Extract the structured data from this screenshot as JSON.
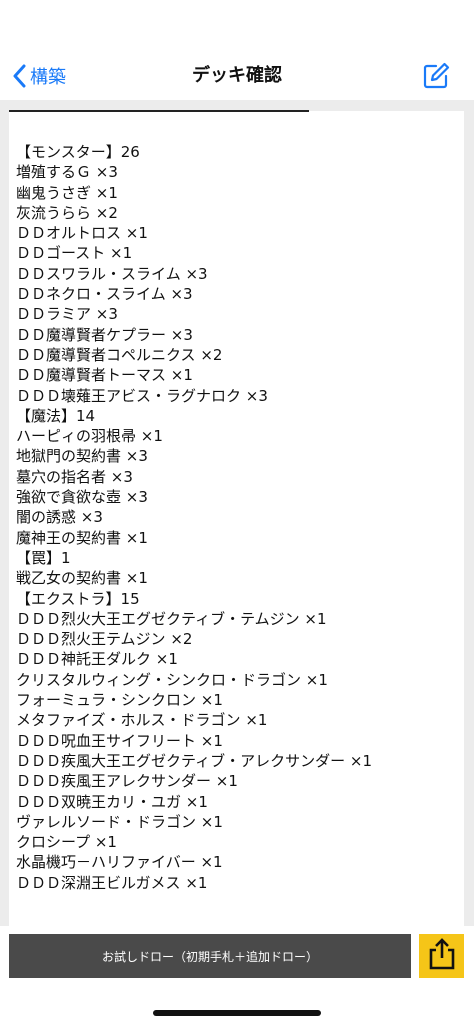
{
  "nav": {
    "back_label": "構築",
    "title": "デッキ確認"
  },
  "deck_lines": [
    "【モンスター】26",
    "増殖するＧ ×3",
    "幽鬼うさぎ ×1",
    "灰流うらら ×2",
    "ＤＤオルトロス ×1",
    "ＤＤゴースト ×1",
    "ＤＤスワラル・スライム ×3",
    "ＤＤネクロ・スライム ×3",
    "ＤＤラミア ×3",
    "ＤＤ魔導賢者ケプラー ×3",
    "ＤＤ魔導賢者コペルニクス ×2",
    "ＤＤ魔導賢者トーマス ×1",
    "ＤＤＤ壊薙王アビス・ラグナロク ×3",
    "【魔法】14",
    "ハーピィの羽根帚 ×1",
    "地獄門の契約書 ×3",
    "墓穴の指名者 ×3",
    "強欲で貪欲な壺 ×3",
    "闇の誘惑 ×3",
    "魔神王の契約書 ×1",
    "【罠】1",
    "戦乙女の契約書 ×1",
    "【エクストラ】15",
    "ＤＤＤ烈火大王エグゼクティブ・テムジン ×1",
    "ＤＤＤ烈火王テムジン ×2",
    "ＤＤＤ神託王ダルク ×1",
    "クリスタルウィング・シンクロ・ドラゴン ×1",
    "フォーミュラ・シンクロン ×1",
    "メタファイズ・ホルス・ドラゴン ×1",
    "ＤＤＤ呪血王サイフリート ×1",
    "ＤＤＤ疾風大王エグゼクティブ・アレクサンダー ×1",
    "ＤＤＤ疾風王アレクサンダー ×1",
    "ＤＤＤ双暁王カリ・ユガ ×1",
    "ヴァレルソード・ドラゴン ×1",
    "クロシープ ×1",
    "水晶機巧－ハリファイバー ×1",
    "ＤＤＤ深淵王ビルガメス ×1"
  ],
  "bottom": {
    "draw_label": "お試しドロー（初期手札＋追加ドロー）"
  },
  "colors": {
    "accent": "#1a7af8",
    "share_button": "#f5c518",
    "draw_button": "#4a4a4a",
    "content_background": "#ececec"
  },
  "icons": {
    "back": "chevron-left-icon",
    "edit": "compose-icon",
    "share": "share-icon"
  }
}
